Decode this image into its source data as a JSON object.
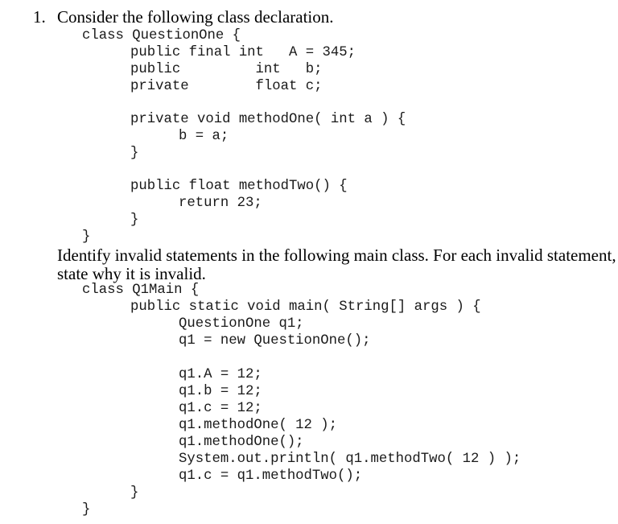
{
  "question": {
    "number": "1.",
    "intro": "Consider the following class declaration.",
    "class_code": [
      "class QuestionOne {",
      "public final int   A = 345;",
      "public         int   b;",
      "private        float c;",
      "private void methodOne( int a ) {",
      "b = a;",
      "}",
      "public float methodTwo() {",
      "return 23;",
      "}",
      "}"
    ],
    "instruction_line1": "Identify invalid statements in the following main class.  For each invalid statement,",
    "instruction_line2": "state why it is invalid.",
    "main_code": [
      "class Q1Main {",
      "public static void main( String[] args ) {",
      "QuestionOne q1;",
      "q1 = new QuestionOne();",
      "q1.A = 12;",
      "q1.b = 12;",
      "q1.c = 12;",
      "q1.methodOne( 12 );",
      "q1.methodOne();",
      "System.out.println( q1.methodTwo( 12 ) );",
      "q1.c = q1.methodTwo();",
      "}",
      "}"
    ]
  }
}
